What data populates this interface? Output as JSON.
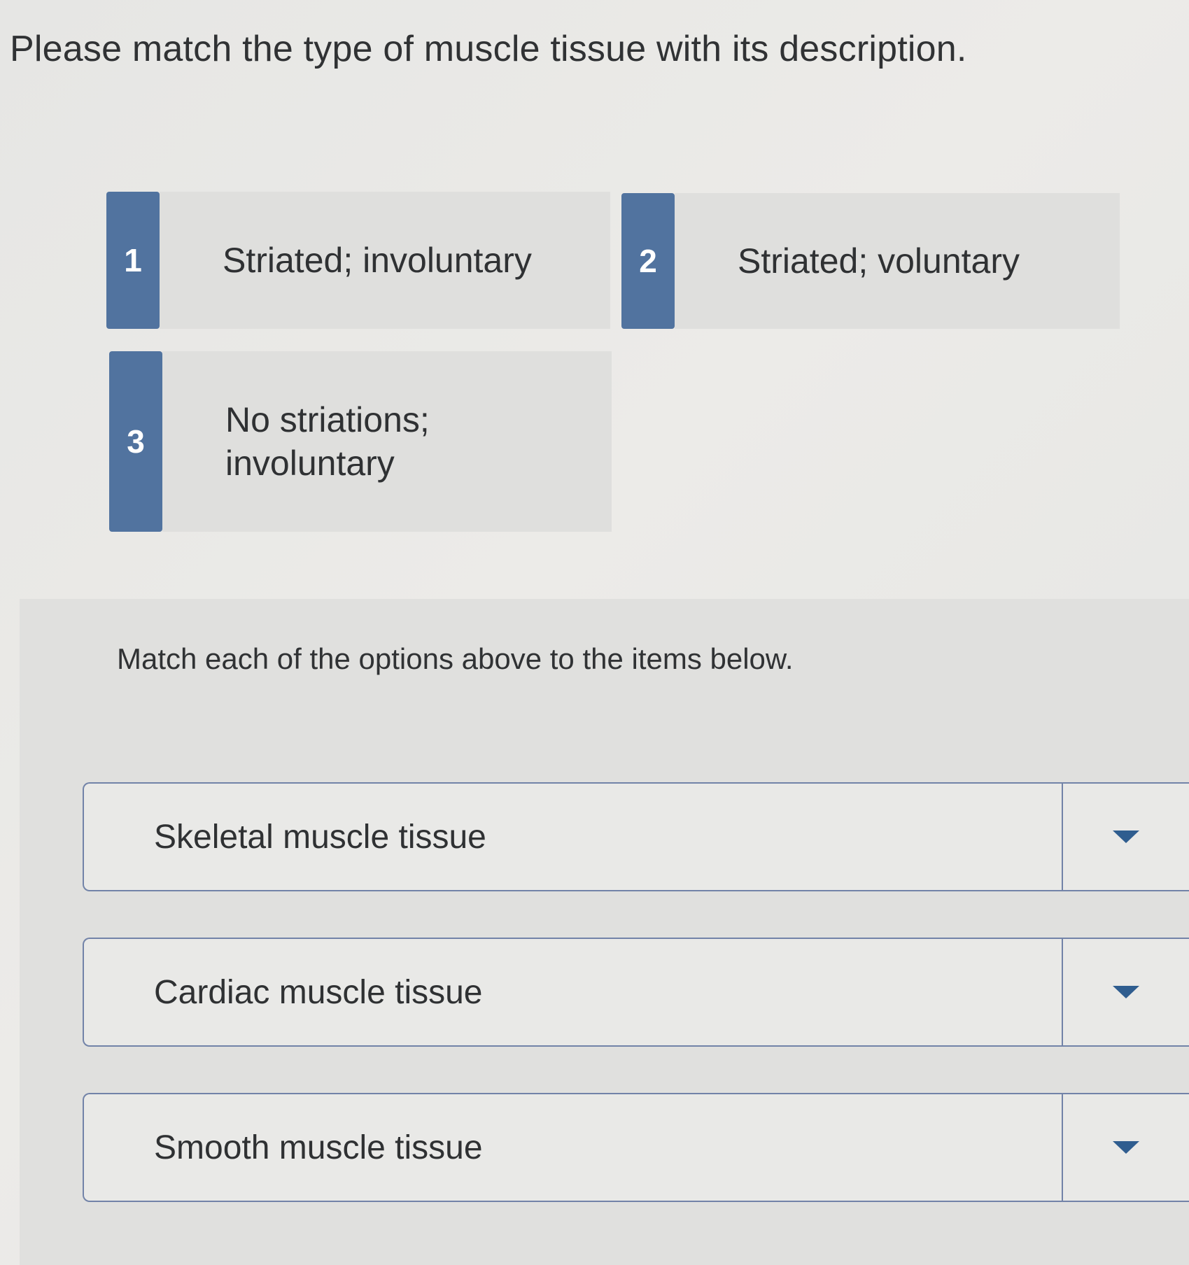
{
  "question": "Please match the type of muscle tissue with its description.",
  "options": [
    {
      "number": "1",
      "text": "Striated; involuntary"
    },
    {
      "number": "2",
      "text": "Striated; voluntary"
    },
    {
      "number": "3",
      "text": "No striations; involuntary"
    }
  ],
  "instructions": "Match each of the options above to the items below.",
  "items": [
    {
      "label": "Skeletal muscle tissue",
      "selected": ""
    },
    {
      "label": "Cardiac muscle tissue",
      "selected": ""
    },
    {
      "label": "Smooth muscle tissue",
      "selected": ""
    }
  ],
  "colors": {
    "accent": "#51739f",
    "border": "#7283a8",
    "caret": "#2f5d8f"
  },
  "icons": {
    "dropdown": "caret-down-icon"
  }
}
